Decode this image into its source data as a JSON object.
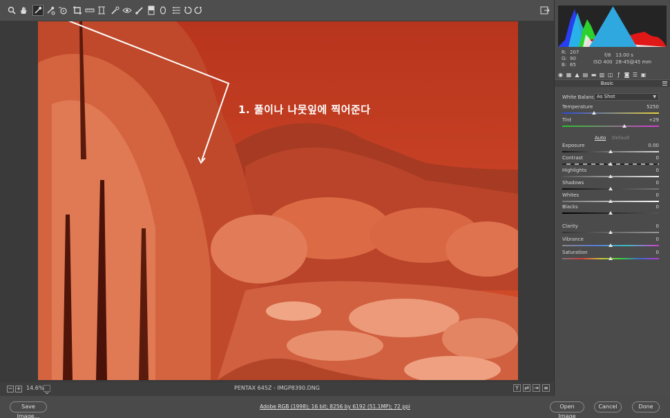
{
  "toolbar": {
    "tools": [
      {
        "name": "zoom-tool",
        "icon": "magnifier"
      },
      {
        "name": "hand-tool",
        "icon": "hand"
      },
      {
        "name": "white-balance-tool",
        "icon": "eyedropper",
        "active": true
      },
      {
        "name": "color-sampler-tool",
        "icon": "eyedropper-plus"
      },
      {
        "name": "targeted-adjustment-tool",
        "icon": "target"
      },
      {
        "name": "crop-tool",
        "icon": "crop"
      },
      {
        "name": "straighten-tool",
        "icon": "level"
      },
      {
        "name": "transform-tool",
        "icon": "transform"
      },
      {
        "name": "spot-removal-tool",
        "icon": "brush-spot"
      },
      {
        "name": "red-eye-tool",
        "icon": "eye"
      },
      {
        "name": "adjustment-brush-tool",
        "icon": "brush"
      },
      {
        "name": "graduated-filter-tool",
        "icon": "gradient"
      },
      {
        "name": "radial-filter-tool",
        "icon": "ellipse"
      },
      {
        "name": "preferences-tool",
        "icon": "list"
      },
      {
        "name": "rotate-ccw-tool",
        "icon": "rotate-left"
      },
      {
        "name": "rotate-cw-tool",
        "icon": "rotate-right"
      }
    ],
    "fullscreen_icon": "fullscreen-toggle"
  },
  "canvas": {
    "annotation": "1. 풀이나 나뭇잎에 찍어준다",
    "photo_color": "#c94a2a"
  },
  "canvas_status": {
    "zoom_out": "−",
    "zoom_in": "+",
    "zoom": "14.6%",
    "filename": "PENTAX 645Z  -  IMGP8390.DNG",
    "view_y": "Y"
  },
  "histogram": {
    "colors": {
      "red": "#e01818",
      "green": "#2cd12c",
      "blue": "#2a3ef0",
      "cyan": "#29c6e8",
      "white": "#f0f0f0"
    }
  },
  "readout": {
    "r_label": "R:",
    "r_value": "207",
    "g_label": "G:",
    "g_value": "90",
    "b_label": "B:",
    "b_value": "65",
    "aperture": "f/8",
    "shutter": "13.00 s",
    "iso": "ISO 400",
    "lens": "28-45@45 mm"
  },
  "panel": {
    "section_title": "Basic",
    "white_balance_label": "White Balance:",
    "white_balance_value": "As Shot",
    "auto_label": "Auto",
    "default_label": "Default",
    "sliders": [
      {
        "key": "temperature",
        "label": "Temperature",
        "value": "5250",
        "position": 0.33
      },
      {
        "key": "tint",
        "label": "Tint",
        "value": "+29",
        "position": 0.645
      },
      {
        "key": "exposure",
        "label": "Exposure",
        "value": "0.00",
        "position": 0.5
      },
      {
        "key": "contrast",
        "label": "Contrast",
        "value": "0",
        "position": 0.5
      },
      {
        "key": "highlights",
        "label": "Highlights",
        "value": "0",
        "position": 0.5
      },
      {
        "key": "shadows",
        "label": "Shadows",
        "value": "0",
        "position": 0.5
      },
      {
        "key": "whites",
        "label": "Whites",
        "value": "0",
        "position": 0.5
      },
      {
        "key": "blacks",
        "label": "Blacks",
        "value": "0",
        "position": 0.5
      },
      {
        "key": "clarity",
        "label": "Clarity",
        "value": "0",
        "position": 0.5
      },
      {
        "key": "vibrance",
        "label": "Vibrance",
        "value": "0",
        "position": 0.5
      },
      {
        "key": "saturation",
        "label": "Saturation",
        "value": "0",
        "position": 0.5
      }
    ]
  },
  "bottom": {
    "save_image": "Save Image...",
    "workflow": "Adobe RGB (1998); 16 bit; 8256 by 6192 (51.1MP); 72 ppi",
    "open_image": "Open Image",
    "cancel": "Cancel",
    "done": "Done"
  }
}
